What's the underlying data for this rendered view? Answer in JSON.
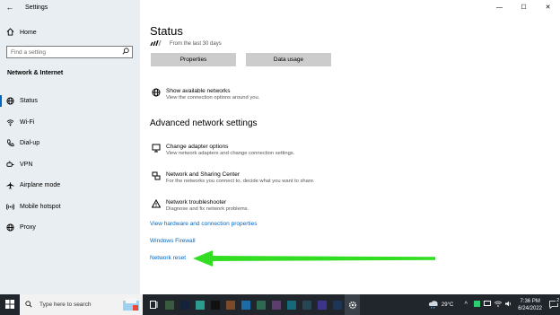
{
  "window": {
    "title": "Settings",
    "controls": {
      "minimize": "—",
      "maximize": "☐",
      "close": "✕"
    }
  },
  "sidebar": {
    "back_glyph": "←",
    "home_label": "Home",
    "search_placeholder": "Find a setting",
    "section_title": "Network & Internet",
    "items": [
      {
        "label": "Status",
        "icon": "globe-icon",
        "active": true
      },
      {
        "label": "Wi-Fi",
        "icon": "wifi-icon"
      },
      {
        "label": "Dial-up",
        "icon": "phone-icon"
      },
      {
        "label": "VPN",
        "icon": "vpn-icon"
      },
      {
        "label": "Airplane mode",
        "icon": "airplane-icon"
      },
      {
        "label": "Mobile hotspot",
        "icon": "hotspot-icon"
      },
      {
        "label": "Proxy",
        "icon": "globe-icon"
      }
    ]
  },
  "main": {
    "title": "Status",
    "data_period": "From the last 30 days",
    "buttons": {
      "properties": "Properties",
      "data_usage": "Data usage"
    },
    "show_networks": {
      "title": "Show available networks",
      "desc": "View the connection options around you."
    },
    "advanced_heading": "Advanced network settings",
    "adapter": {
      "title": "Change adapter options",
      "desc": "View network adapters and change connection settings."
    },
    "sharing": {
      "title": "Network and Sharing Center",
      "desc": "For the networks you connect to, decide what you want to share."
    },
    "troubleshooter": {
      "title": "Network troubleshooter",
      "desc": "Diagnose and fix network problems."
    },
    "links": {
      "hardware": "View hardware and connection properties",
      "firewall": "Windows Firewall",
      "reset": "Network reset"
    }
  },
  "annotation": {
    "arrow_color": "#33dd22"
  },
  "taskbar": {
    "search_text": "Type here to search",
    "weather": "29°C",
    "time": "7:36 PM",
    "date": "6/24/2022",
    "notification_count": "2",
    "accent": "#20262c"
  }
}
